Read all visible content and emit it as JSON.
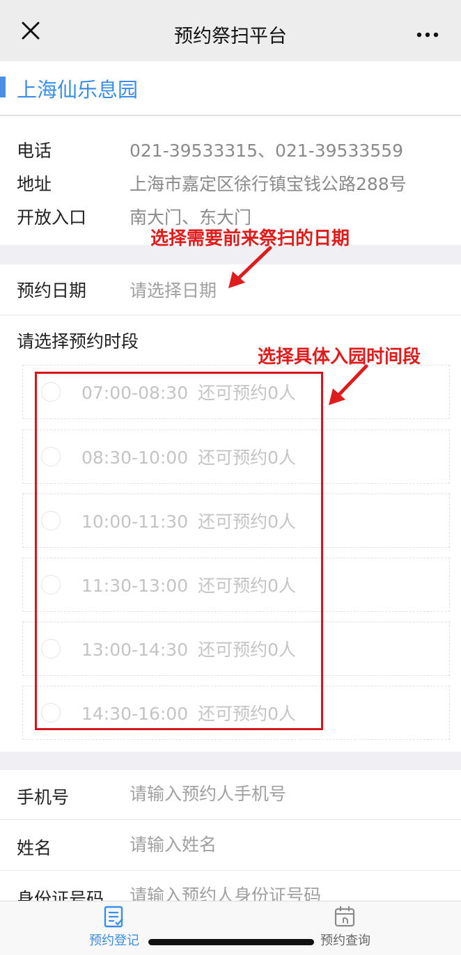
{
  "navbar": {
    "title": "预约祭扫平台"
  },
  "cemetery": {
    "name": "上海仙乐息园"
  },
  "info": {
    "phone_label": "电话",
    "phone_value": "021-39533315、021-39533559",
    "address_label": "地址",
    "address_value": "上海市嘉定区徐行镇宝钱公路288号",
    "entrance_label": "开放入口",
    "entrance_value": "南大门、东大门"
  },
  "reservation": {
    "date_label": "预约日期",
    "date_placeholder": "请选择日期",
    "slot_title": "请选择预约时段",
    "slots": [
      {
        "time": "07:00-08:30",
        "quota": "还可预约0人"
      },
      {
        "time": "08:30-10:00",
        "quota": "还可预约0人"
      },
      {
        "time": "10:00-11:30",
        "quota": "还可预约0人"
      },
      {
        "time": "11:30-13:00",
        "quota": "还可预约0人"
      },
      {
        "time": "13:00-14:30",
        "quota": "还可预约0人"
      },
      {
        "time": "14:30-16:00",
        "quota": "还可预约0人"
      }
    ]
  },
  "annotations": {
    "date_hint": "选择需要前来祭扫的日期",
    "slot_hint": "选择具体入园时间段",
    "color": "#e01b1b"
  },
  "form": {
    "phone_label": "手机号",
    "phone_placeholder": "请输入预约人手机号",
    "name_label": "姓名",
    "name_placeholder": "请输入姓名",
    "id_label": "身份证号码",
    "id_placeholder": "请输入预约人身份证号码"
  },
  "tabbar": {
    "register_label": "预约登记",
    "query_label": "预约查询",
    "active_color": "#3b8ee8"
  },
  "icons": [
    "close-icon",
    "more-icon",
    "register-icon",
    "calendar-icon"
  ]
}
